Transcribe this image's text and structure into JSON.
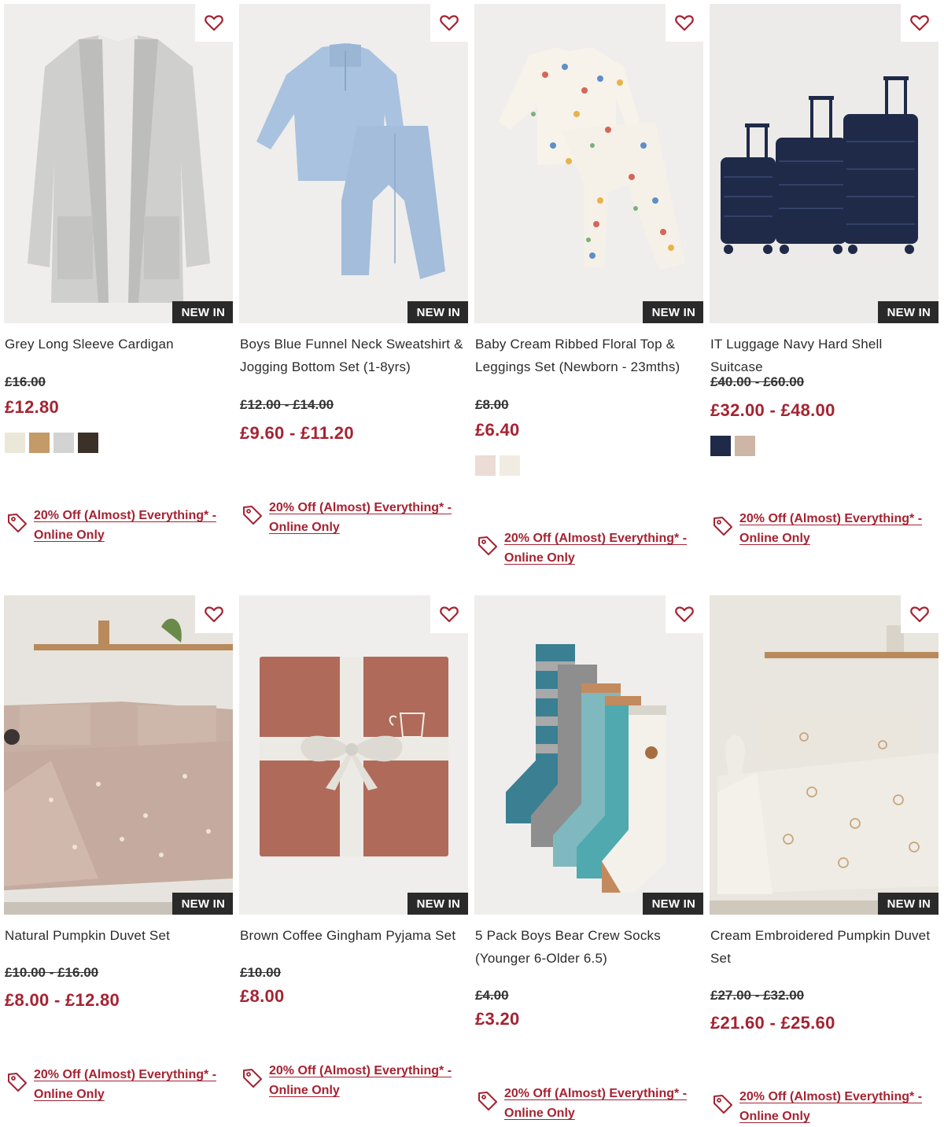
{
  "badge_label": "NEW IN",
  "promo_text": "20% Off (Almost) Everything* - Online Only",
  "accent_color": "#a52332",
  "products": [
    {
      "title": "Grey Long Sleeve Cardigan",
      "was_price": "£16.00",
      "now_price": "£12.80",
      "swatches": [
        "#ece8d9",
        "#c39a68",
        "#d3d3d3",
        "#3b3129"
      ]
    },
    {
      "title": "Boys Blue Funnel Neck Sweatshirt & Jogging Bottom Set (1-8yrs)",
      "was_price": "£12.00 - £14.00",
      "now_price": "£9.60 - £11.20",
      "swatches": []
    },
    {
      "title": "Baby Cream Ribbed Floral Top & Leggings Set (Newborn - 23mths)",
      "was_price": "£8.00",
      "now_price": "£6.40",
      "swatches": [
        "#ecdcd6",
        "#f0ece2"
      ]
    },
    {
      "title": "IT Luggage Navy Hard Shell Suitcase",
      "was_price": "£40.00 - £60.00",
      "now_price": "£32.00 - £48.00",
      "swatches": [
        "#1e2a48",
        "#cdb6a6"
      ]
    },
    {
      "title": "Natural Pumpkin Duvet Set",
      "was_price": "£10.00 - £16.00",
      "now_price": "£8.00 - £12.80",
      "swatches": []
    },
    {
      "title": "Brown Coffee Gingham Pyjama Set",
      "was_price": "£10.00",
      "now_price": "£8.00",
      "swatches": []
    },
    {
      "title": "5 Pack Boys Bear Crew Socks (Younger 6-Older 6.5)",
      "was_price": "£4.00",
      "now_price": "£3.20",
      "swatches": []
    },
    {
      "title": "Cream Embroidered Pumpkin Duvet Set",
      "was_price": "£27.00 - £32.00",
      "now_price": "£21.60 - £25.60",
      "swatches": []
    }
  ]
}
